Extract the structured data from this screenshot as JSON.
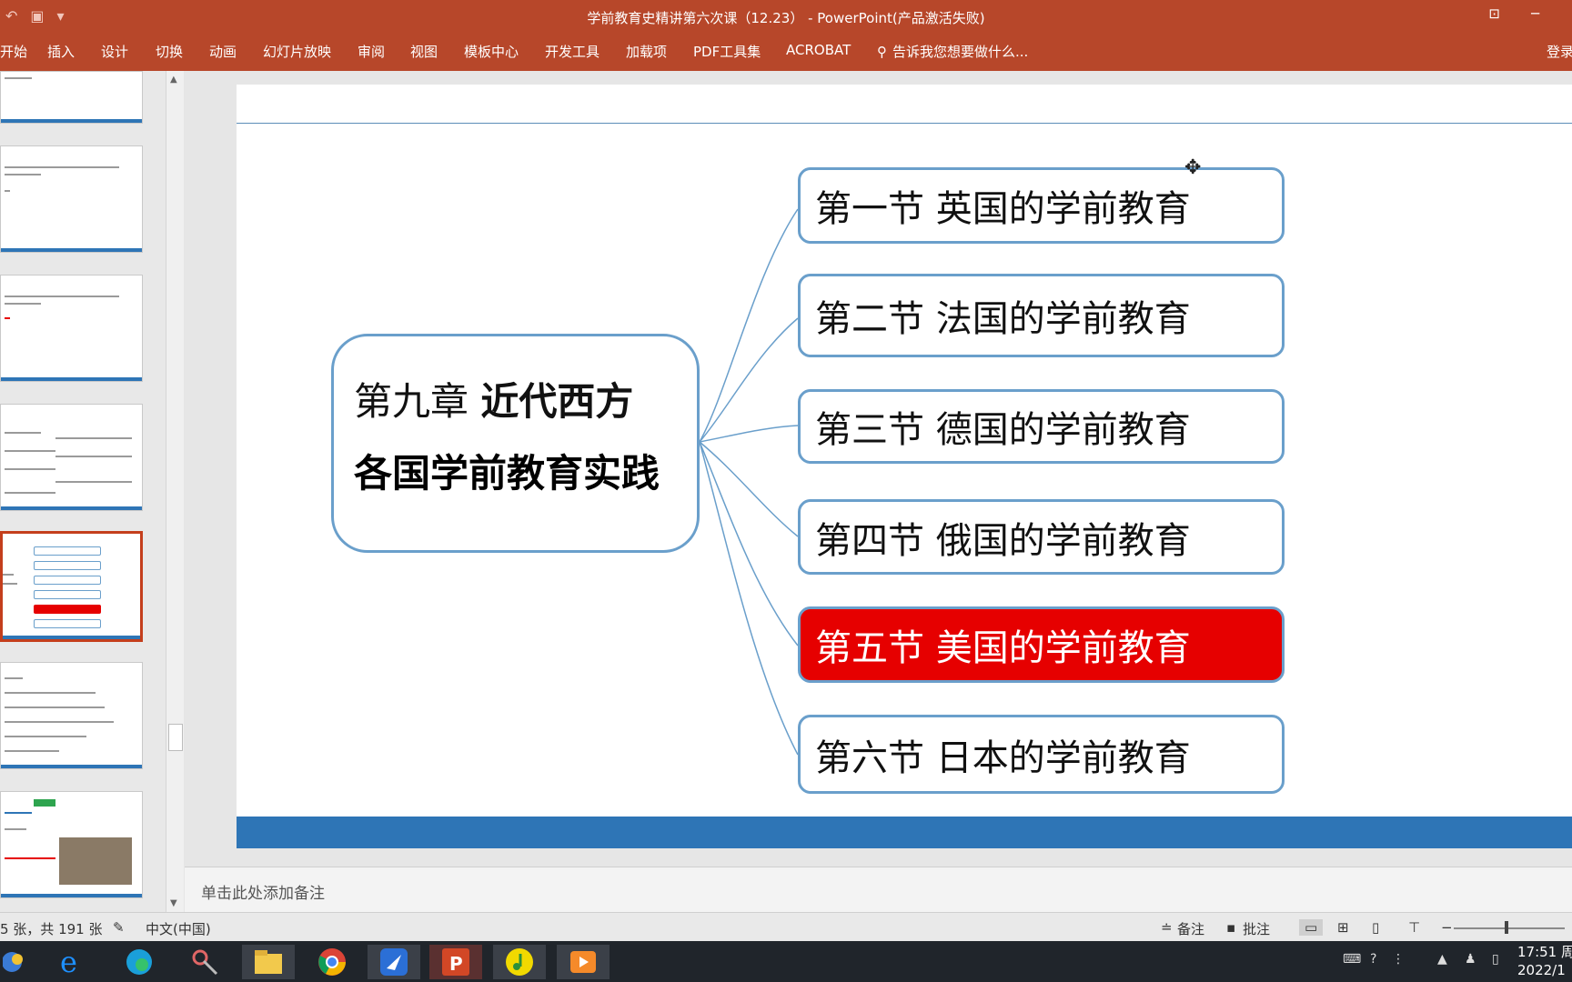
{
  "window": {
    "title": "学前教育史精讲第六次课（12.23） - PowerPoint(产品激活失败)"
  },
  "ribbon": {
    "tabs": [
      "开始",
      "插入",
      "设计",
      "切换",
      "动画",
      "幻灯片放映",
      "审阅",
      "视图",
      "模板中心",
      "开发工具",
      "加载项",
      "PDF工具集",
      "ACROBAT"
    ],
    "tell_me": "告诉我您想要做什么...",
    "login": "登录"
  },
  "slide": {
    "main_title_prefix": "第九章",
    "main_title_bold": "近代西方",
    "main_title_line2": "各国学前教育实践",
    "sections": [
      {
        "label": "第一节 英国的学前教育",
        "highlight": false
      },
      {
        "label": "第二节 法国的学前教育",
        "highlight": false
      },
      {
        "label": "第三节 德国的学前教育",
        "highlight": false
      },
      {
        "label": "第四节 俄国的学前教育",
        "highlight": false
      },
      {
        "label": "第五节 美国的学前教育",
        "highlight": true
      },
      {
        "label": "第六节 日本的学前教育",
        "highlight": false
      }
    ],
    "colors": {
      "accent_bar": "#2e75b6",
      "box_border": "#6a9fcb",
      "highlight": "#e60000"
    }
  },
  "notes": {
    "placeholder": "单击此处添加备注"
  },
  "status": {
    "slide_count": "5 张，共 191 张",
    "language": "中文(中国)",
    "notes_btn": "备注",
    "comments_btn": "批注"
  },
  "clock": {
    "time": "17:51 周",
    "date": "2022/1"
  }
}
